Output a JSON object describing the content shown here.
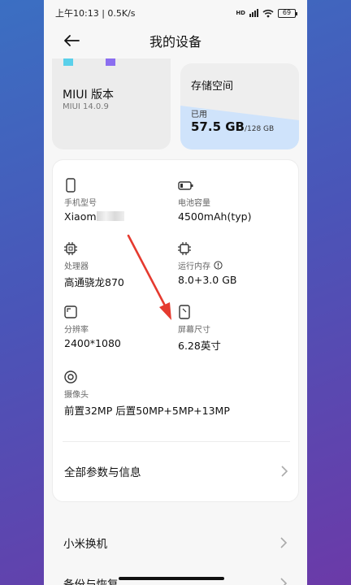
{
  "status_bar": {
    "time_speed": "上午10:13 | 0.5K/s",
    "hd_label": "HD",
    "battery": "69"
  },
  "header": {
    "title": "我的设备"
  },
  "miui_card": {
    "title": "MIUI 版本",
    "version": "MIUI 14.0.9"
  },
  "storage_card": {
    "title": "存储空间",
    "used_label": "已用",
    "used": "57.5 GB",
    "total": "/128 GB",
    "used_fraction": 0.45
  },
  "specs": {
    "model": {
      "label": "手机型号",
      "value": "Xiaom"
    },
    "battery": {
      "label": "电池容量",
      "value": "4500mAh(typ)"
    },
    "cpu": {
      "label": "处理器",
      "value": "高通骁龙870"
    },
    "ram": {
      "label": "运行内存",
      "value": "8.0+3.0 GB"
    },
    "resolution": {
      "label": "分辨率",
      "value": "2400*1080"
    },
    "screen": {
      "label": "屏幕尺寸",
      "value": "6.28英寸"
    },
    "camera": {
      "label": "摄像头",
      "value": "前置32MP 后置50MP+5MP+13MP"
    }
  },
  "all_params": {
    "label": "全部参数与信息"
  },
  "menu": [
    {
      "label": "小米换机"
    },
    {
      "label": "备份与恢复"
    }
  ],
  "colors": {
    "storage_fill": "#cfe3fb",
    "accent_arrow": "#e53a2f"
  }
}
